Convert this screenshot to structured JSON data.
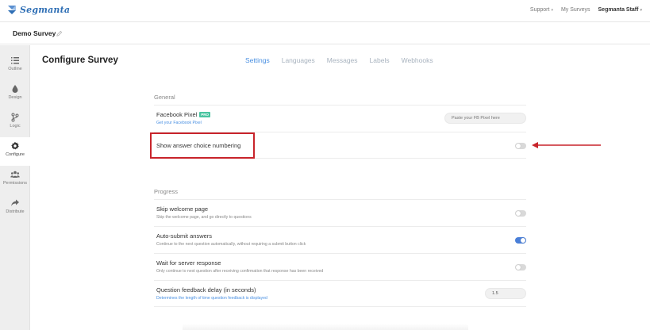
{
  "app": {
    "brand": "Segmanta",
    "brand_color": "#2f6fb5",
    "accent_color": "#4a90e2"
  },
  "topnav": {
    "support": "Support",
    "my_surveys": "My Surveys",
    "user": "Segmanta Staff"
  },
  "survey": {
    "name": "Demo Survey"
  },
  "sidebar": {
    "items": [
      {
        "label": "Outline",
        "icon": "list-icon"
      },
      {
        "label": "Design",
        "icon": "drop-icon"
      },
      {
        "label": "Logic",
        "icon": "branch-icon"
      },
      {
        "label": "Configure",
        "icon": "gear-icon",
        "active": true
      },
      {
        "label": "Permissions",
        "icon": "users-icon"
      },
      {
        "label": "Distribute",
        "icon": "share-icon"
      }
    ]
  },
  "page": {
    "title": "Configure Survey",
    "tabs": [
      {
        "label": "Settings",
        "active": true
      },
      {
        "label": "Languages"
      },
      {
        "label": "Messages"
      },
      {
        "label": "Labels"
      },
      {
        "label": "Webhooks"
      }
    ]
  },
  "general": {
    "heading": "General",
    "facebook": {
      "title": "Facebook Pixel",
      "badge": "PRO",
      "link": "Get your Facebook Pixel",
      "placeholder": "Paste your FB Pixel here"
    },
    "numbering": {
      "title": "Show answer choice numbering",
      "enabled": false
    }
  },
  "progress": {
    "heading": "Progress",
    "skip_welcome": {
      "title": "Skip welcome page",
      "desc": "Skip the welcome page, and go directly to questions",
      "enabled": false
    },
    "auto_submit": {
      "title": "Auto-submit answers",
      "desc": "Continue to the next question automatically, without requiring a submit button click",
      "enabled": true
    },
    "wait_server": {
      "title": "Wait for server response",
      "desc": "Only continue to next question after receiving confirmation that response has been received",
      "enabled": false
    },
    "feedback_delay": {
      "title": "Question feedback delay (in seconds)",
      "desc": "Determines the length of time question feedback is displayed",
      "value": "1.5"
    }
  }
}
